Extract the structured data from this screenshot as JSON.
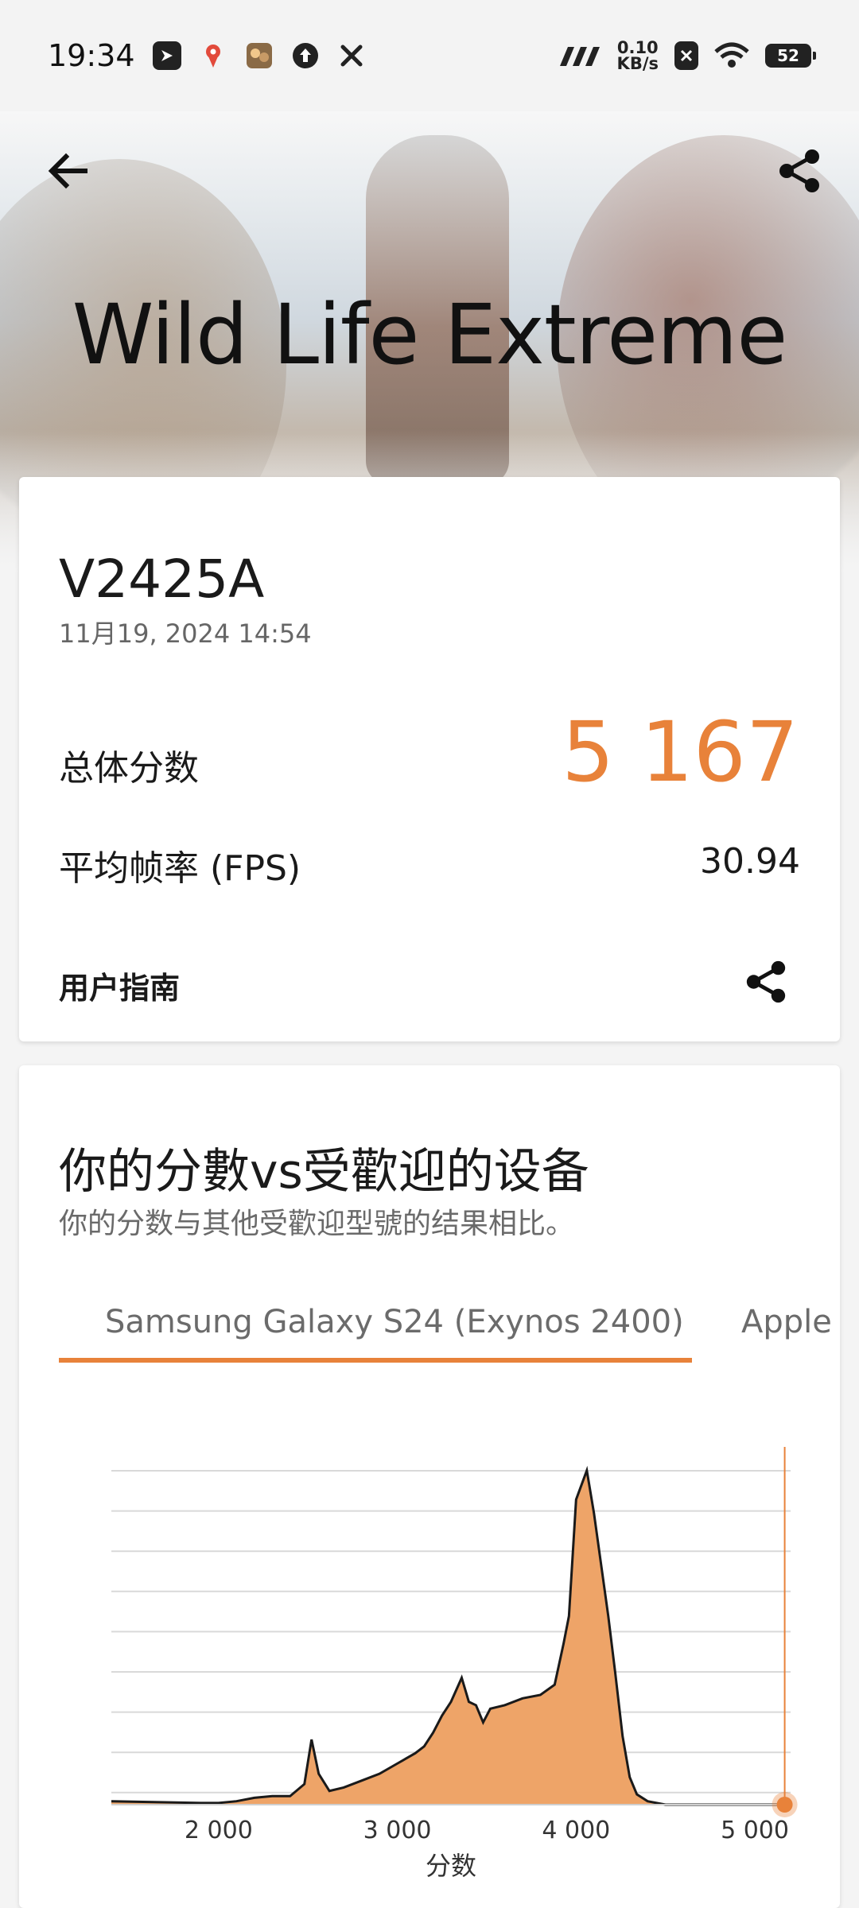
{
  "status_bar": {
    "time": "19:34",
    "net_speed_value": "0.10",
    "net_speed_unit": "KB/s",
    "battery": "52"
  },
  "hero": {
    "title": "Wild Life Extreme"
  },
  "result": {
    "device": "V2425A",
    "date": "11月19, 2024 14:54",
    "overall_label": "总体分数",
    "overall_score": "5 167",
    "fps_label": "平均帧率 (FPS)",
    "fps_value": "30.94",
    "guide_label": "用户指南"
  },
  "comparison": {
    "title": "你的分數vs受歡迎的设备",
    "subtitle": "你的分数与其他受歡迎型號的结果相比。",
    "tabs": [
      {
        "label": "Samsung Galaxy S24 (Exynos 2400)",
        "selected": true
      },
      {
        "label": "Apple",
        "selected": false
      }
    ]
  },
  "colors": {
    "accent": "#e8823a",
    "area_fill": "#eea468",
    "line": "#1a1a1a"
  },
  "chart_data": {
    "type": "area",
    "xlabel": "分数",
    "xlim": [
      1400,
      5200
    ],
    "xticks": [
      2000,
      3000,
      4000,
      5000
    ],
    "xtick_labels": [
      "2 000",
      "3 000",
      "4 000",
      "5 000"
    ],
    "grid": true,
    "marker_score": 5167,
    "series": [
      {
        "x": [
          1400,
          1900,
          2000,
          2100,
          2200,
          2300,
          2400,
          2480,
          2520,
          2560,
          2620,
          2700,
          2800,
          2900,
          3000,
          3100,
          3150,
          3200,
          3250,
          3300,
          3360,
          3400,
          3440,
          3480,
          3520,
          3600,
          3700,
          3800,
          3880,
          3930,
          3960,
          4000,
          4060,
          4100,
          4140,
          4180,
          4220,
          4260,
          4300,
          4340,
          4400,
          4450,
          4500,
          4600,
          4700,
          5000,
          5200
        ],
        "y": [
          2,
          1,
          1,
          2,
          4,
          5,
          5,
          12,
          38,
          18,
          8,
          10,
          14,
          18,
          24,
          30,
          34,
          42,
          52,
          60,
          74,
          60,
          58,
          48,
          56,
          58,
          62,
          64,
          70,
          94,
          110,
          178,
          195,
          170,
          140,
          110,
          76,
          40,
          16,
          6,
          2,
          1,
          0,
          0,
          0,
          0,
          0
        ]
      }
    ]
  }
}
